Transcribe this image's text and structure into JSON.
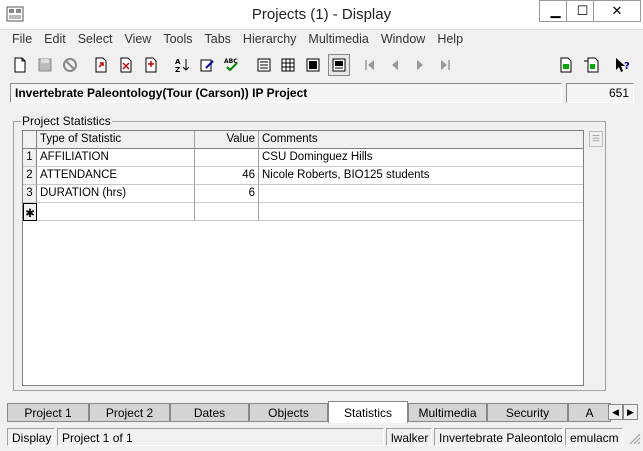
{
  "window": {
    "title": "Projects (1) - Display",
    "min": "▁",
    "max": "☐",
    "close": "✕"
  },
  "menu": [
    "File",
    "Edit",
    "Select",
    "View",
    "Tools",
    "Tabs",
    "Hierarchy",
    "Multimedia",
    "Window",
    "Help"
  ],
  "header": {
    "name": "Invertebrate Paleontology(Tour (Carson)) IP Project",
    "id": "651"
  },
  "group": {
    "label": "Project Statistics"
  },
  "grid": {
    "columns": [
      "Type of Statistic",
      "Value",
      "Comments"
    ],
    "rows": [
      {
        "num": "1",
        "type": "AFFILIATION",
        "value": "",
        "comments": "CSU Dominguez Hills"
      },
      {
        "num": "2",
        "type": "ATTENDANCE",
        "value": "46",
        "comments": "Nicole Roberts, BIO125 students"
      },
      {
        "num": "3",
        "type": "DURATION (hrs)",
        "value": "6",
        "comments": ""
      }
    ],
    "new_row_marker": "✱"
  },
  "tabs": [
    "Project 1",
    "Project 2",
    "Dates",
    "Objects",
    "Statistics",
    "Multimedia",
    "Security",
    "A"
  ],
  "tab_scroll": {
    "left": "◀",
    "right": "▶"
  },
  "status": {
    "mode": "Display",
    "record": "Project 1 of 1",
    "user": "lwalker",
    "module": "Invertebrate Paleontology",
    "db": "emulacm"
  }
}
